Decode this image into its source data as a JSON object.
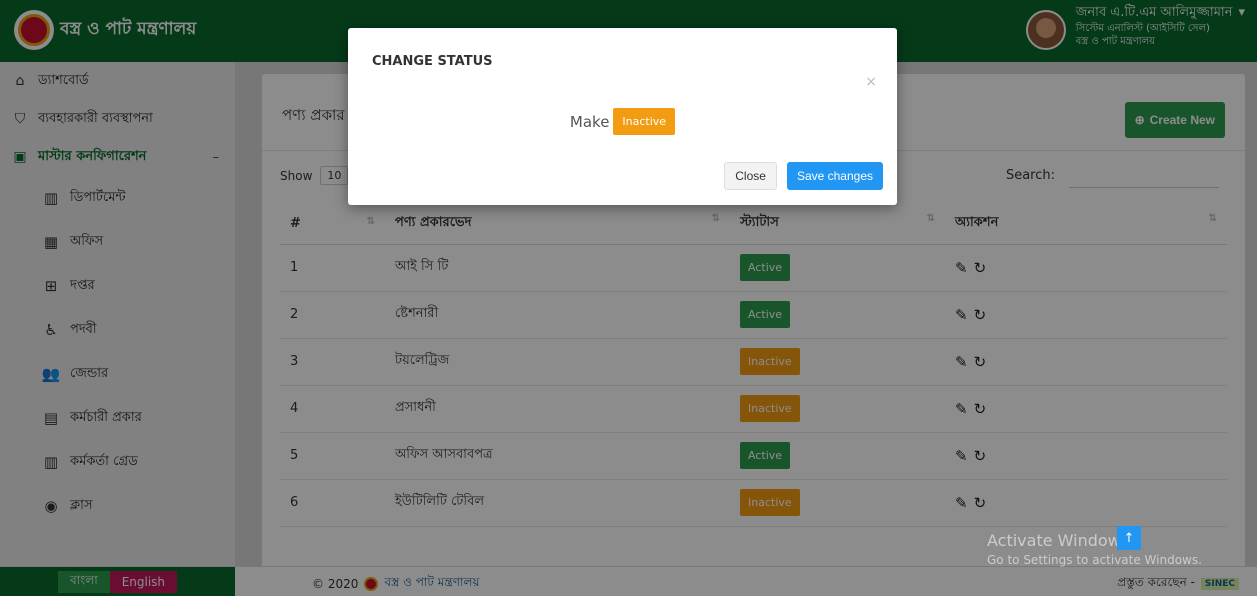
{
  "header": {
    "brand": "বস্ত্র ও পাট মন্ত্রণালয়",
    "user_name": "জনাব এ.টি.এম আলিমুজ্জামান",
    "user_role": "সিস্টেম এনালিস্ট (আইসিটি সেল)",
    "user_org": "বস্ত্র ও পাট মন্ত্রণালয়"
  },
  "sidebar": {
    "items": [
      {
        "label": "ড্যাশবোর্ড",
        "icon": "home-icon"
      },
      {
        "label": "ব্যবহারকারী ব্যবস্থাপনা",
        "icon": "shield-icon"
      },
      {
        "label": "মাস্টার কনফিগারেশন",
        "icon": "monitor-icon",
        "active": true,
        "toggle": "–"
      }
    ],
    "sub_items": [
      {
        "label": "ডিপার্টমেন্ট",
        "icon": "chart-icon"
      },
      {
        "label": "অফিস",
        "icon": "building-icon"
      },
      {
        "label": "দপ্তর",
        "icon": "grid-icon"
      },
      {
        "label": "পদবী",
        "icon": "person-icon"
      },
      {
        "label": "জেন্ডার",
        "icon": "users-icon"
      },
      {
        "label": "কর্মচারী প্রকার",
        "icon": "id-card-icon"
      },
      {
        "label": "কর্মকর্তা গ্রেড",
        "icon": "chart-icon"
      },
      {
        "label": "ক্লাস",
        "icon": "user-circle-icon"
      }
    ]
  },
  "main": {
    "title": "পণ্য প্রকার",
    "create_label": "Create New",
    "show_label": "Show",
    "show_value": "10",
    "search_label": "Search:",
    "columns": [
      "#",
      "পণ্য প্রকারভেদ",
      "স্ট্যাটাস",
      "অ্যাকশন"
    ],
    "rows": [
      {
        "num": "1",
        "name": "আই সি টি",
        "status": "Active"
      },
      {
        "num": "2",
        "name": "ষ্টেশনারী",
        "status": "Active"
      },
      {
        "num": "3",
        "name": "টয়লেট্রিজ",
        "status": "Inactive"
      },
      {
        "num": "4",
        "name": "প্রসাধনী",
        "status": "Inactive"
      },
      {
        "num": "5",
        "name": "অফিস আসবাবপত্র",
        "status": "Active"
      },
      {
        "num": "6",
        "name": "ইউটিলিটি টেবিল",
        "status": "Inactive"
      }
    ]
  },
  "modal": {
    "title": "CHANGE STATUS",
    "close_x": "×",
    "make_label": "Make",
    "status_badge": "Inactive",
    "close_label": "Close",
    "save_label": "Save changes"
  },
  "footer": {
    "lang_bn": "বাংলা",
    "lang_en": "English",
    "copyright": "© 2020",
    "org": "বস্ত্র ও পাট মন্ত্রণালয়",
    "credit": "প্রস্তুত করেছেন -",
    "vendor": "SINEC"
  },
  "watermark": {
    "line1": "Activate Windows",
    "line2": "Go to Settings to activate Windows."
  },
  "colors": {
    "brand_green": "#0a6b2e",
    "active_badge": "#2e9b4f",
    "inactive_badge": "#f39c12",
    "save_blue": "#2196f3",
    "english_pink": "#c2185b"
  }
}
